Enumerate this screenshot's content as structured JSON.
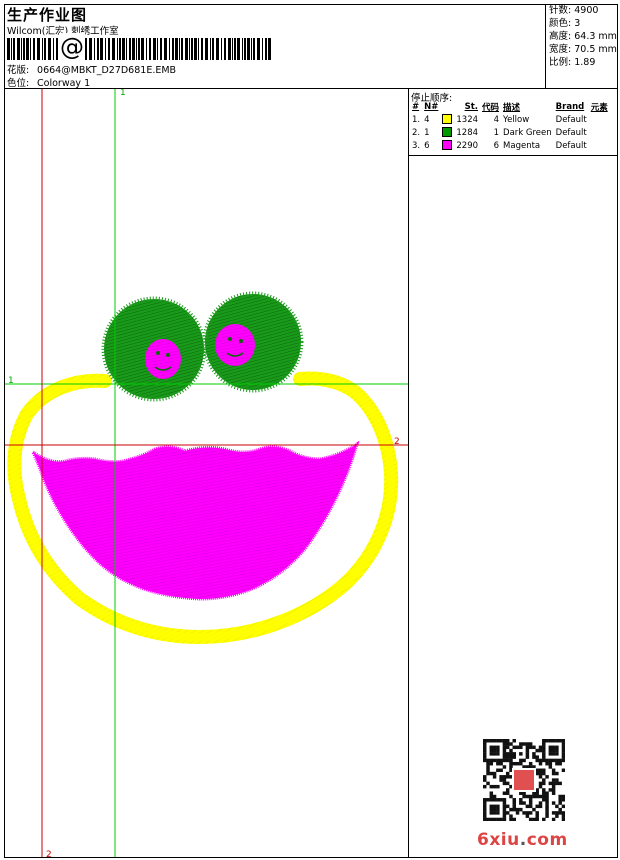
{
  "header": {
    "title": "生产作业图",
    "studio": "Wilcom(汇宏) 刺绣工作室",
    "at_symbol": "@",
    "design_label": "花版:",
    "design_value": "0664@MBKT_D27D681E.EMB",
    "colorway_label": "色位:",
    "colorway_value": "Colorway 1"
  },
  "stats": [
    {
      "label": "针数:",
      "value": "4900"
    },
    {
      "label": "颜色:",
      "value": "3"
    },
    {
      "label": "高度:",
      "value": "64.3 mm"
    },
    {
      "label": "宽度:",
      "value": "70.5 mm"
    },
    {
      "label": "比例:",
      "value": "1.89"
    }
  ],
  "stop_sequence": {
    "title": "停止顺序:",
    "headers": {
      "index": "#",
      "no": "N#",
      "stitches": "St.",
      "code": "代码",
      "desc": "描述",
      "brand": "Brand",
      "element": "元素"
    },
    "rows": [
      {
        "index": "1.",
        "no": "4",
        "color": "#ffff00",
        "stitches": "1324",
        "code": "4",
        "desc": "Yellow",
        "brand": "Default"
      },
      {
        "index": "2.",
        "no": "1",
        "color": "#009900",
        "stitches": "1284",
        "code": "1",
        "desc": "Dark Green",
        "brand": "Default"
      },
      {
        "index": "3.",
        "no": "6",
        "color": "#ff00ff",
        "stitches": "2290",
        "code": "6",
        "desc": "Magenta",
        "brand": "Default"
      }
    ]
  },
  "guides": {
    "green_v": "1",
    "green_h": "1",
    "red_v": "2",
    "red_h": "2"
  },
  "watermark": {
    "main": "6xiu",
    "dot": ".",
    "tld": "com"
  },
  "colors": {
    "yellow": "#ffff00",
    "green": "#1a9a1a",
    "magenta": "#ff00ff",
    "guide_green": "#00cc00",
    "guide_red": "#cc0000"
  }
}
